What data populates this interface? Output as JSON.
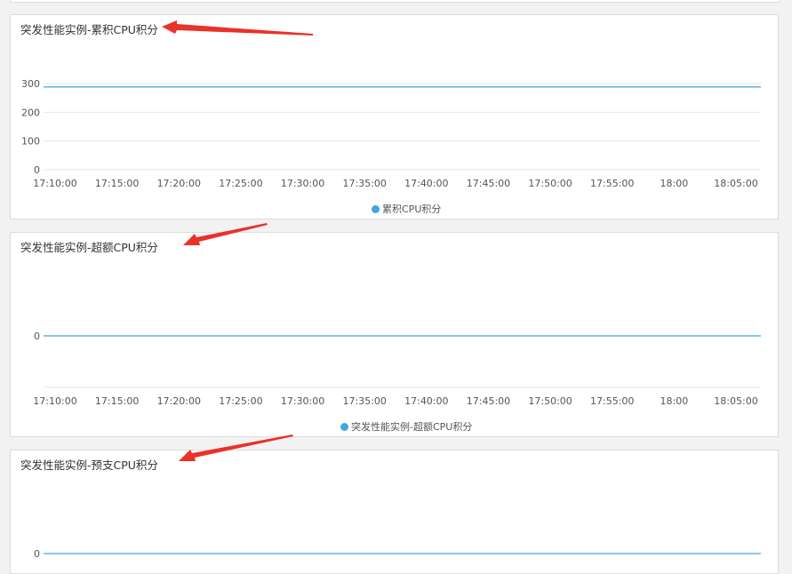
{
  "chart_data": [
    {
      "type": "line",
      "title": "突发性能实例-累积CPU积分",
      "categories": [
        "17:10:00",
        "17:15:00",
        "17:20:00",
        "17:25:00",
        "17:30:00",
        "17:35:00",
        "17:40:00",
        "17:45:00",
        "17:50:00",
        "17:55:00",
        "18:00",
        "18:05:00"
      ],
      "yticks": [
        0,
        100,
        200,
        300
      ],
      "ylim": [
        0,
        300
      ],
      "series": [
        {
          "name": "累积CPU积分",
          "color": "#3fa7e0",
          "values": [
            288,
            288,
            288,
            288,
            288,
            288,
            288,
            288,
            288,
            288,
            288,
            288
          ]
        }
      ],
      "legend": "bottom",
      "grid": true
    },
    {
      "type": "line",
      "title": "突发性能实例-超额CPU积分",
      "categories": [
        "17:10:00",
        "17:15:00",
        "17:20:00",
        "17:25:00",
        "17:30:00",
        "17:35:00",
        "17:40:00",
        "17:45:00",
        "17:50:00",
        "17:55:00",
        "18:00",
        "18:05:00"
      ],
      "yticks": [
        0
      ],
      "series": [
        {
          "name": "突发性能实例-超额CPU积分",
          "color": "#3fa7e0",
          "values": [
            0,
            0,
            0,
            0,
            0,
            0,
            0,
            0,
            0,
            0,
            0,
            0
          ]
        }
      ],
      "legend": "bottom",
      "grid": true
    },
    {
      "type": "line",
      "title": "突发性能实例-预支CPU积分",
      "yticks": [
        0
      ],
      "series": [
        {
          "color": "#3fa7e0",
          "values": [
            0,
            0,
            0,
            0,
            0,
            0,
            0,
            0,
            0,
            0,
            0,
            0
          ]
        }
      ],
      "grid": true
    }
  ],
  "annotation_color": "#e8322a"
}
